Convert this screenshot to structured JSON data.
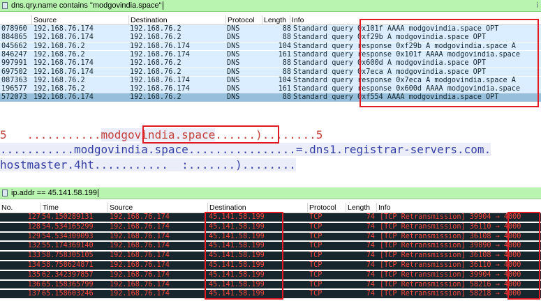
{
  "dns": {
    "filter": "dns.qry.name contains \"modgovindia.space\"",
    "filter_end": "ⅰ",
    "columns": [
      "Source",
      "Destination",
      "Protocol",
      "Length",
      "Info"
    ],
    "rows": [
      {
        "no": "078960",
        "src": "192.168.76.174",
        "dst": "192.168.76.2",
        "proto": "DNS",
        "len": "88",
        "info": "Standard query 0x101f AAAA modgovindia.space OPT",
        "selected": false
      },
      {
        "no": "884865",
        "src": "192.168.76.174",
        "dst": "192.168.76.2",
        "proto": "DNS",
        "len": "88",
        "info": "Standard query 0xf29b A modgovindia.space OPT",
        "selected": false
      },
      {
        "no": "045662",
        "src": "192.168.76.2",
        "dst": "192.168.76.174",
        "proto": "DNS",
        "len": "104",
        "info": "Standard query response 0xf29b A modgovindia.space A",
        "selected": false
      },
      {
        "no": "846247",
        "src": "192.168.76.2",
        "dst": "192.168.76.174",
        "proto": "DNS",
        "len": "161",
        "info": "Standard query response 0x101f AAAA modgovindia.space",
        "selected": false
      },
      {
        "no": "997991",
        "src": "192.168.76.174",
        "dst": "192.168.76.2",
        "proto": "DNS",
        "len": "88",
        "info": "Standard query 0x600d A modgovindia.space OPT",
        "selected": false
      },
      {
        "no": "697502",
        "src": "192.168.76.174",
        "dst": "192.168.76.2",
        "proto": "DNS",
        "len": "88",
        "info": "Standard query 0x7eca A modgovindia.space OPT",
        "selected": false
      },
      {
        "no": "087363",
        "src": "192.168.76.2",
        "dst": "192.168.76.174",
        "proto": "DNS",
        "len": "104",
        "info": "Standard query response 0x7eca A modgovindia.space A",
        "selected": false
      },
      {
        "no": "196577",
        "src": "192.168.76.2",
        "dst": "192.168.76.174",
        "proto": "DNS",
        "len": "161",
        "info": "Standard query response 0x600d AAAA modgovindia.space",
        "selected": false
      },
      {
        "no": "572073",
        "src": "192.168.76.174",
        "dst": "192.168.76.2",
        "proto": "DNS",
        "len": "88",
        "info": "Standard query 0xf554 AAAA modgovindia.space OPT",
        "selected": true
      }
    ]
  },
  "stream": {
    "line1_pre": "5   ...........",
    "line1_domain": "modgovindia.space",
    "line1_post": "......)........5",
    "line2": "...........modgovindia.space................=.dns1.registrar-servers.com.",
    "line3": "hostmaster.4ht...........  :.......)........"
  },
  "tcp": {
    "filter": "ip.addr == 45.141.58.199",
    "columns": [
      "No.",
      "Time",
      "Source",
      "Destination",
      "Protocol",
      "Length",
      "Info"
    ],
    "rows": [
      {
        "no": "127",
        "time": "54.150289131",
        "src": "192.168.76.174",
        "dst": "45.141.58.199",
        "proto": "TCP",
        "len": "74",
        "info": "[TCP Retransmission] 39904 → 4000"
      },
      {
        "no": "128",
        "time": "54.534165299",
        "src": "192.168.76.174",
        "dst": "45.141.58.199",
        "proto": "TCP",
        "len": "74",
        "info": "[TCP Retransmission] 36110 → 4000"
      },
      {
        "no": "129",
        "time": "54.534309093",
        "src": "192.168.76.174",
        "dst": "45.141.58.199",
        "proto": "TCP",
        "len": "74",
        "info": "[TCP Retransmission] 36108 → 4000"
      },
      {
        "no": "132",
        "time": "55.174369140",
        "src": "192.168.76.174",
        "dst": "45.141.58.199",
        "proto": "TCP",
        "len": "74",
        "info": "[TCP Retransmission] 39890 → 4000"
      },
      {
        "no": "133",
        "time": "58.758305105",
        "src": "192.168.76.174",
        "dst": "45.141.58.199",
        "proto": "TCP",
        "len": "74",
        "info": "[TCP Retransmission] 36108 → 4000"
      },
      {
        "no": "134",
        "time": "58.758624871",
        "src": "192.168.76.174",
        "dst": "45.141.58.199",
        "proto": "TCP",
        "len": "74",
        "info": "[TCP Retransmission] 36110 → 4000"
      },
      {
        "no": "135",
        "time": "62.342397857",
        "src": "192.168.76.174",
        "dst": "45.141.58.199",
        "proto": "TCP",
        "len": "74",
        "info": "[TCP Retransmission] 39904 → 4000"
      },
      {
        "no": "136",
        "time": "65.158365799",
        "src": "192.168.76.174",
        "dst": "45.141.58.199",
        "proto": "TCP",
        "len": "74",
        "info": "[TCP Retransmission] 58216 → 4000"
      },
      {
        "no": "137",
        "time": "65.158603246",
        "src": "192.168.76.174",
        "dst": "45.141.58.199",
        "proto": "TCP",
        "len": "74",
        "info": "[TCP Retransmission] 58218 → 4000"
      }
    ]
  },
  "colors": {
    "highlight_box": "#e01b24",
    "dns_row_bg": "#daeeff",
    "dns_selected_bg": "#97bfdc",
    "tcp_row_bg": "#17252d",
    "tcp_row_text": "#f6473c",
    "filter_ok_bg": "#b9f5b1",
    "stream_client": "#c4423c",
    "stream_server": "#3641a6"
  }
}
